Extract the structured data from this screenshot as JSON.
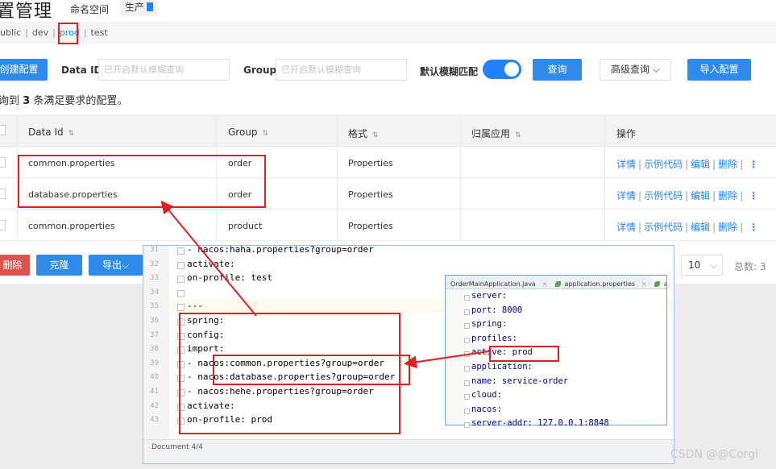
{
  "header": {
    "title": "置管理",
    "namespace_label": "命名空间",
    "env_tag": "生产"
  },
  "namespaces": [
    "ublic",
    "dev",
    "prod",
    "test"
  ],
  "search": {
    "create_label": "创建配置",
    "create_visible": "创建配置",
    "dataid_label": "Data ID",
    "dataid_placeholder": "已开启默认模糊查询",
    "group_label": "Group",
    "group_placeholder": "已开启默认模糊查询",
    "fuzzy_label": "默认模糊匹配",
    "fuzzy_on": true,
    "query_label": "查询",
    "advanced_label": "高级查询 ⌵",
    "import_label": "导入配置"
  },
  "result": {
    "prefix": "询到 ",
    "count": "3",
    "suffix": " 条满足要求的配置。"
  },
  "table": {
    "headers": {
      "dataid": "Data Id",
      "group": "Group",
      "format": "格式",
      "app": "归属应用",
      "ops": "操作"
    },
    "rows": [
      {
        "dataid": "common.properties",
        "group": "order",
        "format": "Properties",
        "app": ""
      },
      {
        "dataid": "database.properties",
        "group": "order",
        "format": "Properties",
        "app": ""
      },
      {
        "dataid": "common.properties",
        "group": "product",
        "format": "Properties",
        "app": ""
      }
    ],
    "ops": {
      "detail": "详情",
      "sample": "示例代码",
      "edit": "编辑",
      "delete": "删除",
      "more": "⋮"
    }
  },
  "footer": {
    "delete_label": "删除",
    "clone_label": "克隆",
    "export_label": "导出⌵",
    "page_size": "10",
    "total": "总数: 3"
  },
  "ide": {
    "line_numbers": [
      "31",
      "32",
      "33",
      "34",
      "35",
      "36",
      "37",
      "38",
      "39",
      "40",
      "41",
      "42",
      "43"
    ],
    "lines": [
      "    - nacos:haha.properties?group=order",
      "  activate:",
      "    on-profile: test",
      "",
      "---",
      "spring:",
      "  config:",
      "    import:",
      "      - nacos:common.properties?group=order",
      "      - nacos:database.properties?group=order",
      "      - nacos:hehe.properties?group=order",
      "  activate:",
      "    on-profile: prod"
    ],
    "status": "Document 4/4"
  },
  "inner_editor": {
    "tabs": [
      "OrderMainApplication.java",
      "application.properties",
      "applic"
    ],
    "lines": [
      "server:",
      "  port: 8000",
      "spring:",
      "  profiles:",
      "    active: prod",
      "  application:",
      "    name: service-order",
      "  cloud:",
      "    nacos:",
      "      server-addr: 127.0.0.1:8848"
    ]
  },
  "watermark": "CSDN @@Corgi",
  "colors": {
    "accent": "#1f82ff",
    "button": "#2f8bea",
    "danger": "#d9534f",
    "annotation": "#e02020"
  }
}
